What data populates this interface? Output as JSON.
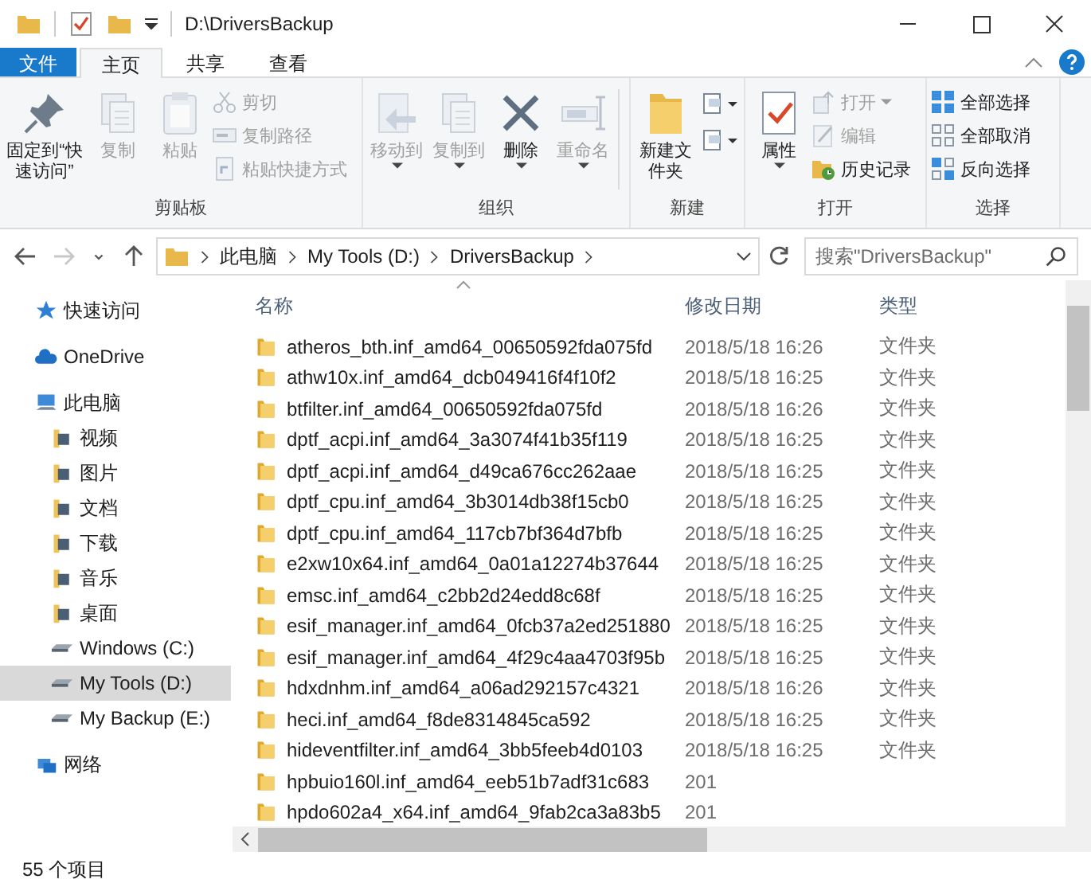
{
  "window": {
    "title": "D:\\DriversBackup"
  },
  "ribbon_tabs": [
    {
      "label": "文件",
      "kind": "file",
      "selected": false
    },
    {
      "label": "主页",
      "kind": "tab",
      "selected": true
    },
    {
      "label": "共享",
      "kind": "tab",
      "selected": false
    },
    {
      "label": "查看",
      "kind": "tab",
      "selected": false
    }
  ],
  "ribbon_groups": [
    {
      "label": "剪贴板",
      "items": [
        {
          "label": "固定到“快速访问”",
          "kind": "large",
          "disabled": false
        },
        {
          "label": "复制",
          "kind": "large",
          "disabled": true
        },
        {
          "label": "粘贴",
          "kind": "large",
          "disabled": true
        },
        {
          "label": "剪切",
          "kind": "small",
          "disabled": true
        },
        {
          "label": "复制路径",
          "kind": "small",
          "disabled": true
        },
        {
          "label": "粘贴快捷方式",
          "kind": "small",
          "disabled": true
        }
      ]
    },
    {
      "label": "组织",
      "items": [
        {
          "label": "移动到",
          "kind": "large",
          "disabled": true
        },
        {
          "label": "复制到",
          "kind": "large",
          "disabled": true
        },
        {
          "label": "删除",
          "kind": "large",
          "disabled": false
        },
        {
          "label": "重命名",
          "kind": "large",
          "disabled": true
        }
      ]
    },
    {
      "label": "新建",
      "items": [
        {
          "label": "新建文件夹",
          "kind": "large",
          "disabled": false
        },
        {
          "kind": "icon",
          "disabled": false
        },
        {
          "kind": "icon",
          "disabled": false
        }
      ]
    },
    {
      "label": "打开",
      "items": [
        {
          "label": "属性",
          "kind": "large",
          "disabled": false
        },
        {
          "label": "打开",
          "kind": "small",
          "disabled": true
        },
        {
          "label": "编辑",
          "kind": "small",
          "disabled": true
        },
        {
          "label": "历史记录",
          "kind": "small",
          "disabled": false
        }
      ]
    },
    {
      "label": "选择",
      "items": [
        {
          "label": "全部选择",
          "kind": "small",
          "disabled": false
        },
        {
          "label": "全部取消",
          "kind": "small",
          "disabled": false
        },
        {
          "label": "反向选择",
          "kind": "small",
          "disabled": false
        }
      ]
    }
  ],
  "navigation": [
    {
      "kind": "back",
      "disabled": false
    },
    {
      "kind": "forward",
      "disabled": true
    },
    {
      "kind": "recent",
      "disabled": false
    },
    {
      "kind": "up",
      "disabled": false
    }
  ],
  "address": {
    "crumbs": [
      "此电脑",
      "My Tools (D:)",
      "DriversBackup"
    ]
  },
  "search": {
    "placeholder": "搜索\"DriversBackup\""
  },
  "sidebar": {
    "items": [
      {
        "label": "快速访问",
        "kind": "star",
        "selected": false
      },
      {
        "label": "OneDrive",
        "kind": "cloud",
        "selected": false
      },
      {
        "label": "此电脑",
        "kind": "pc",
        "selected": false,
        "children": [
          {
            "label": "视频",
            "kind": "folder",
            "selected": false
          },
          {
            "label": "图片",
            "kind": "folder",
            "selected": false
          },
          {
            "label": "文档",
            "kind": "folder",
            "selected": false
          },
          {
            "label": "下载",
            "kind": "folder",
            "selected": false
          },
          {
            "label": "音乐",
            "kind": "folder",
            "selected": false
          },
          {
            "label": "桌面",
            "kind": "folder",
            "selected": false
          },
          {
            "label": "Windows (C:)",
            "kind": "drive",
            "selected": false
          },
          {
            "label": "My Tools (D:)",
            "kind": "drive",
            "selected": true
          },
          {
            "label": "My Backup (E:)",
            "kind": "drive",
            "selected": false
          }
        ]
      },
      {
        "label": "网络",
        "kind": "network",
        "selected": false
      }
    ]
  },
  "table": {
    "columns": [
      "名称",
      "修改日期",
      "类型"
    ],
    "rows": [
      {
        "name": "atheros_bth.inf_amd64_00650592fda075fd",
        "date": "2018/5/18 16:26",
        "type": "文件夹"
      },
      {
        "name": "athw10x.inf_amd64_dcb049416f4f10f2",
        "date": "2018/5/18 16:25",
        "type": "文件夹"
      },
      {
        "name": "btfilter.inf_amd64_00650592fda075fd",
        "date": "2018/5/18 16:26",
        "type": "文件夹"
      },
      {
        "name": "dptf_acpi.inf_amd64_3a3074f41b35f119",
        "date": "2018/5/18 16:25",
        "type": "文件夹"
      },
      {
        "name": "dptf_acpi.inf_amd64_d49ca676cc262aae",
        "date": "2018/5/18 16:25",
        "type": "文件夹"
      },
      {
        "name": "dptf_cpu.inf_amd64_3b3014db38f15cb0",
        "date": "2018/5/18 16:25",
        "type": "文件夹"
      },
      {
        "name": "dptf_cpu.inf_amd64_117cb7bf364d7bfb",
        "date": "2018/5/18 16:25",
        "type": "文件夹"
      },
      {
        "name": "e2xw10x64.inf_amd64_0a01a12274b37644",
        "date": "2018/5/18 16:25",
        "type": "文件夹"
      },
      {
        "name": "emsc.inf_amd64_c2bb2d24edd8c68f",
        "date": "2018/5/18 16:25",
        "type": "文件夹"
      },
      {
        "name": "esif_manager.inf_amd64_0fcb37a2ed251880",
        "date": "2018/5/18 16:25",
        "type": "文件夹"
      },
      {
        "name": "esif_manager.inf_amd64_4f29c4aa4703f95b",
        "date": "2018/5/18 16:25",
        "type": "文件夹"
      },
      {
        "name": "hdxdnhm.inf_amd64_a06ad292157c4321",
        "date": "2018/5/18 16:26",
        "type": "文件夹"
      },
      {
        "name": "heci.inf_amd64_f8de8314845ca592",
        "date": "2018/5/18 16:25",
        "type": "文件夹"
      },
      {
        "name": "hideventfilter.inf_amd64_3bb5feeb4d0103",
        "date": "2018/5/18 16:25",
        "type": "文件夹"
      },
      {
        "name": "hpbuio160l.inf_amd64_eeb51b7adf31c683",
        "date": "201"
      },
      {
        "name": "hpdo602a4_x64.inf_amd64_9fab2ca3a83b5",
        "date": "201"
      }
    ]
  },
  "status_bar": {
    "count": "55 个项目"
  }
}
